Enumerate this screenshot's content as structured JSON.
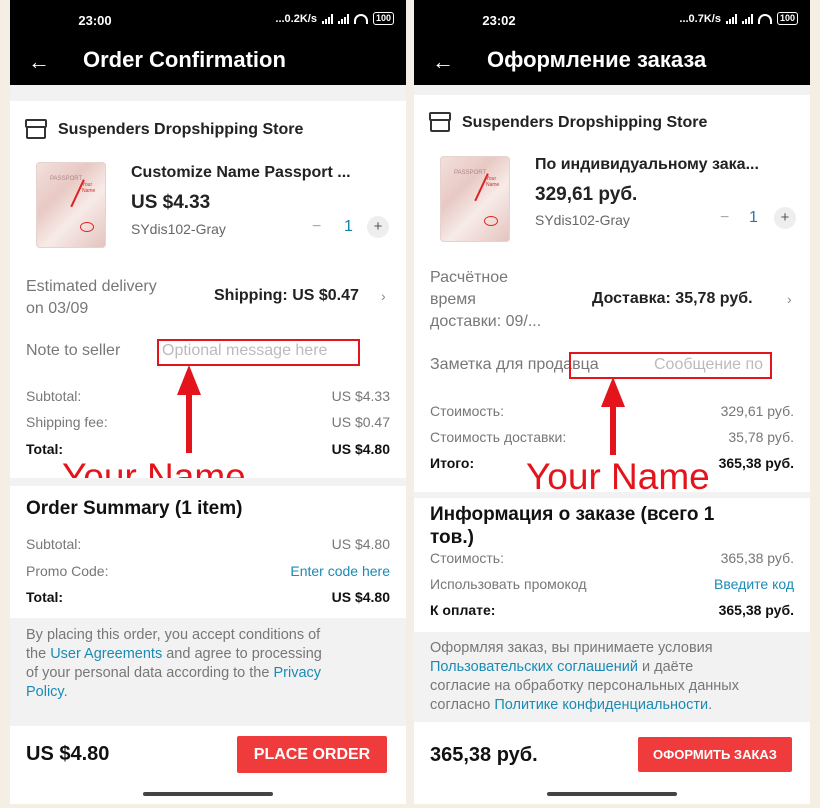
{
  "left": {
    "status": {
      "time": "23:00",
      "speed": "...0.2K/s",
      "battery": "100"
    },
    "header": {
      "back_icon": "arrow-left-icon",
      "title": "Order Confirmation"
    },
    "store": {
      "name": "Suspenders Dropshipping Store"
    },
    "product": {
      "name": "Customize Name Passport ...",
      "price": "US $4.33",
      "sku": "SYdis102-Gray",
      "qty_minus": "−",
      "qty": "1",
      "qty_plus": "+"
    },
    "delivery": {
      "label_line1": "Estimated delivery",
      "label_line2": "on 03/09",
      "shipping": "Shipping: US $0.47"
    },
    "note": {
      "label": "Note to seller",
      "placeholder": "Optional message here"
    },
    "summary_rows": [
      {
        "label": "Subtotal:",
        "value": "US $4.33"
      },
      {
        "label": "Shipping fee:",
        "value": "US $0.47"
      },
      {
        "label": "Total:",
        "value": "US $4.80"
      }
    ],
    "annotation": "Your Name",
    "order_summary": {
      "title": "Order Summary (1 item)",
      "subtotal_label": "Subtotal:",
      "subtotal_value": "US $4.80",
      "promo_label": "Promo Code:",
      "promo_link": "Enter code here",
      "total_label": "Total:",
      "total_value": "US $4.80"
    },
    "policy": {
      "p1": "By placing this order, you accept conditions of",
      "p2a": "the ",
      "link1": "User Agreements",
      "p2b": " and agree to processing",
      "p3a": "of your personal data according to the ",
      "link2": "Privacy",
      "link2b": "Policy",
      "p4": "."
    },
    "bottom": {
      "total": "US $4.80",
      "button": "PLACE ORDER"
    }
  },
  "right": {
    "status": {
      "time": "23:02",
      "speed": "...0.7K/s",
      "battery": "100"
    },
    "header": {
      "back_icon": "arrow-left-icon",
      "title": "Оформление заказа"
    },
    "store": {
      "name": "Suspenders Dropshipping Store"
    },
    "product": {
      "name": "По индивидуальному зака...",
      "price": "329,61 руб.",
      "sku": "SYdis102-Gray",
      "qty_minus": "−",
      "qty": "1",
      "qty_plus": "+"
    },
    "delivery": {
      "label_line1": "Расчётное",
      "label_line2": "время",
      "label_line3": "доставки: 09/...",
      "shipping": "Доставка: 35,78 руб."
    },
    "note": {
      "label": "Заметка для продавца",
      "placeholder": "Сообщение по"
    },
    "summary_rows": [
      {
        "label": "Стоимость:",
        "value": "329,61 руб."
      },
      {
        "label": "Стоимость доставки:",
        "value": "35,78 руб."
      },
      {
        "label": "Итого:",
        "value": "365,38 руб."
      }
    ],
    "annotation": "Your Name",
    "order_summary": {
      "title_line1": "Информация о заказе (всего 1",
      "title_line2": "тов.)",
      "subtotal_label": "Стоимость:",
      "subtotal_value": "365,38 руб.",
      "promo_label": "Использовать промокод",
      "promo_link": "Введите код",
      "total_label": "К оплате:",
      "total_value": "365,38 руб."
    },
    "policy": {
      "p1": "Оформляя заказ, вы принимаете условия",
      "link1": "Пользовательских соглашений",
      "p2b": " и даёте",
      "p3": "согласие на обработку персональных данных",
      "p4a": "согласно ",
      "link2": "Политике конфиденциальности",
      "p4b": "."
    },
    "bottom": {
      "total": "365,38 руб.",
      "button": "ОФОРМИТЬ ЗАКАЗ"
    }
  },
  "colors": {
    "accent_red": "#ef3b3b",
    "annotation_red": "#e3141c",
    "link_blue": "#1a8bb4"
  }
}
